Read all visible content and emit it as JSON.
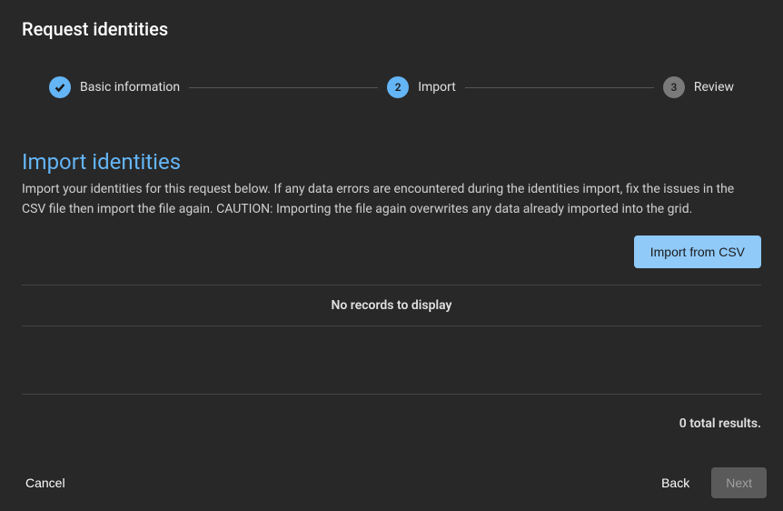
{
  "dialog": {
    "title": "Request identities"
  },
  "steps": [
    {
      "num": "",
      "label": "Basic information",
      "state": "done"
    },
    {
      "num": "2",
      "label": "Import",
      "state": "active"
    },
    {
      "num": "3",
      "label": "Review",
      "state": "upcoming"
    }
  ],
  "section": {
    "title": "Import identities",
    "description": "Import your identities for this request below. If any data errors are encountered during the identities import, fix the issues in the CSV file then import the file again. CAUTION: Importing the file again overwrites any data already imported into the grid."
  },
  "buttons": {
    "import_csv": "Import from CSV",
    "cancel": "Cancel",
    "back": "Back",
    "next": "Next"
  },
  "grid": {
    "empty_message": "No records to display",
    "total_results_text": "0 total results."
  }
}
